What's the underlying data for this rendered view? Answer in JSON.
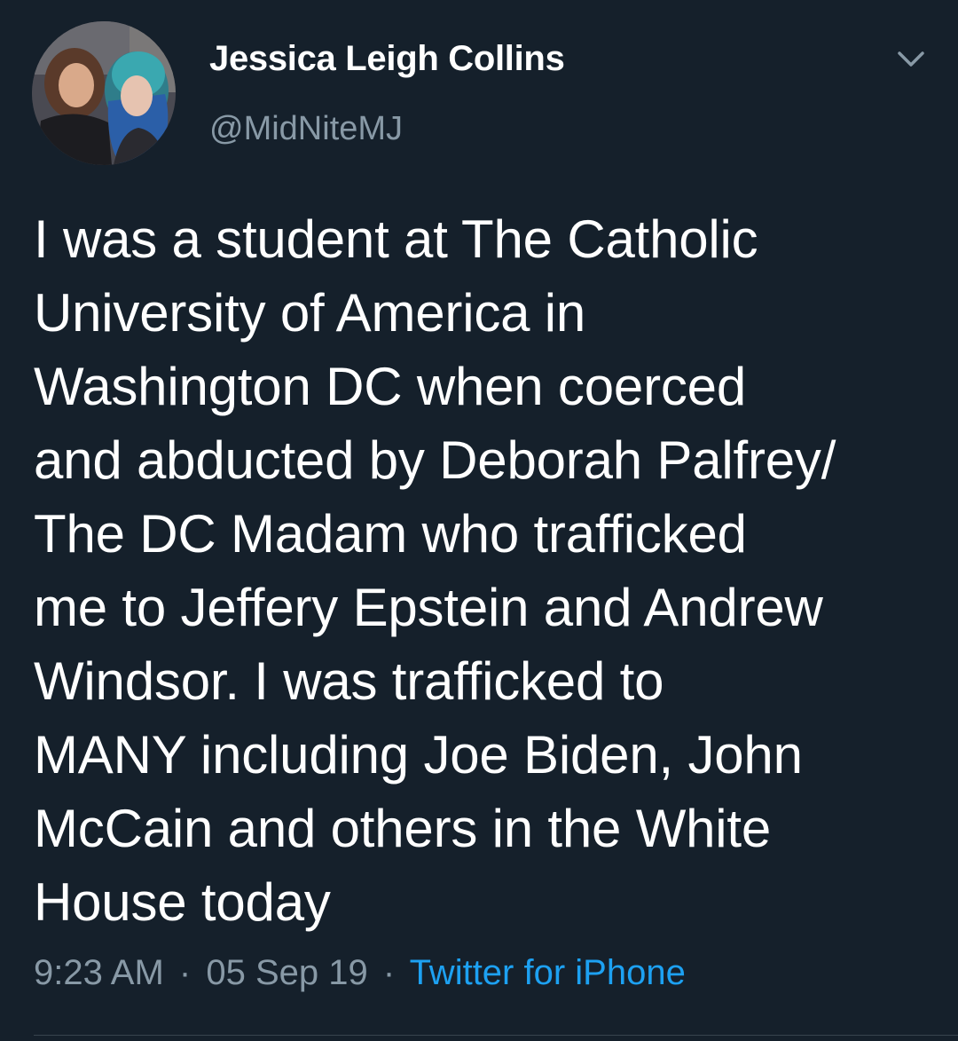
{
  "user": {
    "display_name": "Jessica Leigh Collins",
    "handle": "@MidNiteMJ"
  },
  "tweet": {
    "lines": [
      "I was a student at The Catholic",
      "University of America in",
      "Washington DC when coerced",
      "and abducted by Deborah Palfrey/",
      "The DC Madam who trafficked",
      "me to Jeffery Epstein and Andrew",
      "Windsor. I was trafficked to",
      "MANY including Joe Biden, John",
      "McCain and others in the White",
      "House today"
    ],
    "time": "9:23 AM",
    "separator": "·",
    "date": "05 Sep 19",
    "source": "Twitter for iPhone"
  },
  "icons": {
    "caret": "chevron-down-icon"
  },
  "colors": {
    "background": "#15202b",
    "text": "#ffffff",
    "secondary_text": "#8899a6",
    "link": "#1da1f2",
    "divider": "#38444d"
  }
}
